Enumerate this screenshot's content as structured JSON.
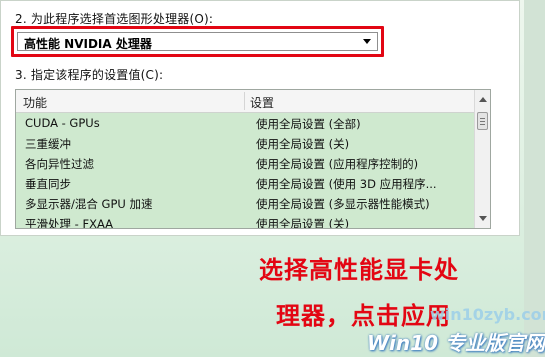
{
  "step2_label": "2. 为此程序选择首选图形处理器(O):",
  "dropdown_value": "高性能 NVIDIA 处理器",
  "step3_label": "3. 指定该程序的设置值(C):",
  "list": {
    "headers": {
      "feature": "功能",
      "setting": "设置"
    },
    "rows": [
      {
        "feature": "CUDA - GPUs",
        "setting": "使用全局设置 (全部)"
      },
      {
        "feature": "三重缓冲",
        "setting": "使用全局设置 (关)"
      },
      {
        "feature": "各向异性过滤",
        "setting": "使用全局设置 (应用程序控制的)"
      },
      {
        "feature": "垂直同步",
        "setting": "使用全局设置 (使用 3D 应用程序..."
      },
      {
        "feature": "多显示器/混合 GPU 加速",
        "setting": "使用全局设置 (多显示器性能模式)"
      },
      {
        "feature": "平滑处理 - FXAA",
        "setting": "使用全局设置 (关)"
      }
    ]
  },
  "caption": {
    "line1": "选择高性能显卡处",
    "line2": "理器，点击应用"
  },
  "watermark": {
    "brand": "Win10 专业版官网",
    "url": "win10zyb.com"
  },
  "colors": {
    "highlight_border": "#e20613",
    "caption_text": "#e30613",
    "list_bg": "#cfe9cf"
  }
}
